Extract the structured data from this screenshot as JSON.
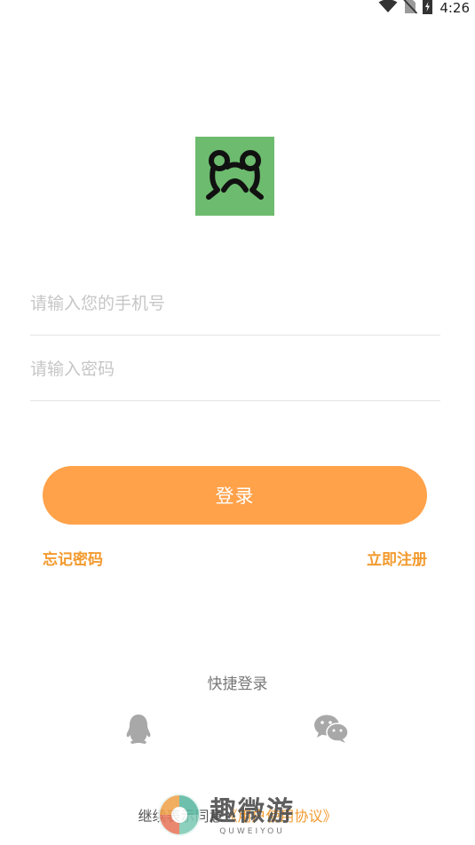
{
  "status_bar": {
    "time": "4:26",
    "icons": [
      "wifi-icon",
      "no-sim-icon",
      "battery-charging-icon"
    ]
  },
  "logo": {
    "icon": "frog-face-logo",
    "background_color": "#6dbb6e"
  },
  "login_form": {
    "phone_placeholder": "请输入您的手机号",
    "password_placeholder": "请输入密码",
    "submit_label": "登录"
  },
  "links": {
    "forgot_password": "忘记密码",
    "register": "立即注册"
  },
  "quick_login": {
    "title": "快捷登录",
    "providers": [
      "qq-icon",
      "wechat-icon"
    ]
  },
  "agreement": {
    "prefix": "继续表示同意",
    "link": "《用户使用协议》"
  },
  "watermark": {
    "text": "趣微游",
    "subtext": "QUWEIYOU"
  },
  "colors": {
    "accent": "#ffa24a",
    "link": "#f29a2e"
  }
}
